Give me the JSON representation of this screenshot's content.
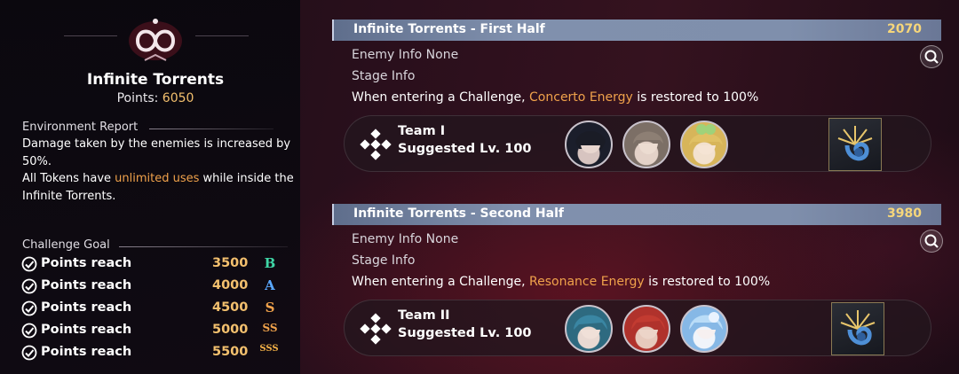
{
  "left": {
    "title": "Infinite Torrents",
    "points_label": "Points:",
    "points_value": "6050",
    "env_header": "Environment Report",
    "env_line1": "Damage taken by the enemies is increased by 50%.",
    "env_line2_pre": "All Tokens have ",
    "env_line2_highlight": "unlimited uses",
    "env_line2_post": " while inside the Infinite Torrents.",
    "goal_header": "Challenge Goal",
    "goals": [
      {
        "label": "Points reach",
        "value": "3500",
        "rank": "B",
        "rank_color": "#3fd6a6"
      },
      {
        "label": "Points reach",
        "value": "4000",
        "rank": "A",
        "rank_color": "#5aa8ff"
      },
      {
        "label": "Points reach",
        "value": "4500",
        "rank": "S",
        "rank_color": "#f0a24b"
      },
      {
        "label": "Points reach",
        "value": "5000",
        "rank": "SS",
        "rank_color": "#f0a24b"
      },
      {
        "label": "Points reach",
        "value": "5500",
        "rank": "SSS",
        "rank_color": "#f5b247"
      }
    ]
  },
  "stages": [
    {
      "title": "Infinite Torrents - First Half",
      "score": "2070",
      "enemy_info": "Enemy Info  None",
      "stage_info": "Stage Info",
      "challenge_pre": "When entering a Challenge, ",
      "challenge_highlight": "Concerto Energy",
      "challenge_post": " is restored to 100%",
      "team_name": "Team I",
      "team_level": "Suggested Lv. 100"
    },
    {
      "title": "Infinite Torrents - Second Half",
      "score": "3980",
      "enemy_info": "Enemy Info  None",
      "stage_info": "Stage Info",
      "challenge_pre": "When entering a Challenge, ",
      "challenge_highlight": "Resonance Energy",
      "challenge_post": " is restored to 100%",
      "team_name": "Team II",
      "team_level": "Suggested Lv. 100"
    }
  ],
  "icons": {
    "search": "search-icon",
    "check": "check-icon",
    "team": "team-icon",
    "token": "token-icon",
    "emblem": "torrent-emblem-icon"
  },
  "colors": {
    "accent": "#f0a24b",
    "score": "#f6d67a",
    "header_bar": "#7f8fac"
  }
}
